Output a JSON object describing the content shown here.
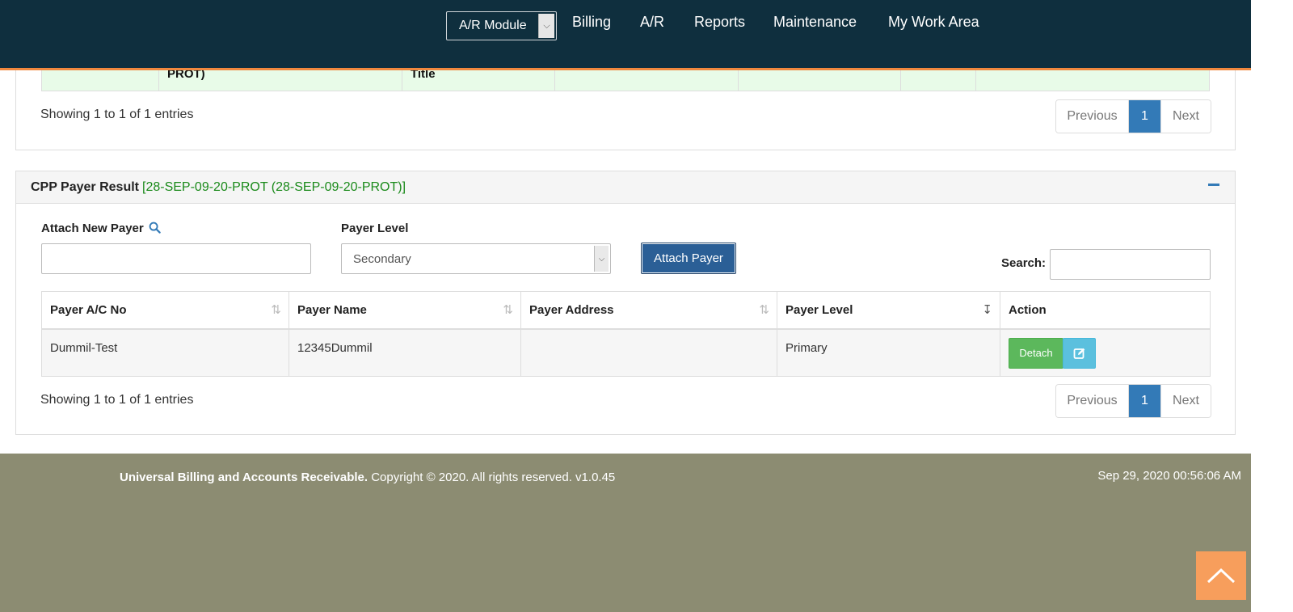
{
  "nav": {
    "module_selected": "A/R Module",
    "items": [
      "Billing",
      "A/R",
      "Reports",
      "Maintenance",
      "My Work Area"
    ]
  },
  "upper_table": {
    "partial_cells": [
      "PROT)",
      "Title"
    ],
    "info": "Showing 1 to 1 of 1 entries",
    "pager": {
      "prev": "Previous",
      "current": "1",
      "next": "Next"
    }
  },
  "cpp_panel": {
    "title": "CPP Payer Result",
    "subtitle": "[28-SEP-09-20-PROT (28-SEP-09-20-PROT)]",
    "attach_new_payer_label": "Attach New Payer",
    "attach_new_payer_value": "",
    "payer_level_label": "Payer Level",
    "payer_level_selected": "Secondary",
    "attach_button": "Attach Payer",
    "search_label": "Search:",
    "search_value": "",
    "table": {
      "headers": [
        "Payer A/C No",
        "Payer Name",
        "Payer Address",
        "Payer Level",
        "Action"
      ],
      "rows": [
        {
          "acct": "Dummil-Test",
          "name": "12345Dummil",
          "address": "",
          "level": "Primary",
          "detach": "Detach"
        }
      ]
    },
    "info": "Showing 1 to 1 of 1 entries",
    "pager": {
      "prev": "Previous",
      "current": "1",
      "next": "Next"
    }
  },
  "footer": {
    "brand": "Universal Billing and Accounts Receivable.",
    "copyright": "Copyright © 2020. All rights reserved. v1.0.45",
    "datetime": "Sep 29, 2020 00:56:06 AM"
  },
  "colors": {
    "nav_bg": "#0f2f3e",
    "nav_accent": "#f0883e",
    "primary": "#337ab7",
    "success": "#5cb85c",
    "info": "#5bc0de",
    "footer_bg": "#8c8c72",
    "subtitle_green": "#1a8a1a"
  }
}
